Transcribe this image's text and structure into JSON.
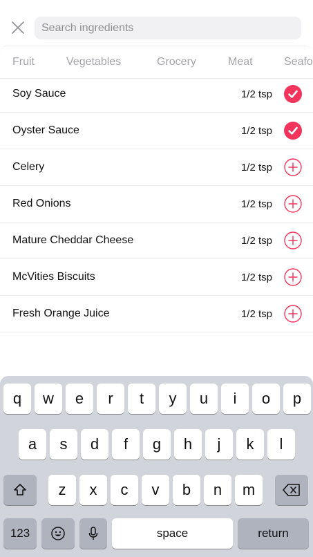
{
  "search": {
    "placeholder": "Search ingredients",
    "value": ""
  },
  "categories": [
    "Fruit",
    "Vegetables",
    "Grocery",
    "Meat",
    "Seafood"
  ],
  "ingredients": [
    {
      "name": "Soy Sauce",
      "qty": "1/2 tsp",
      "added": true
    },
    {
      "name": "Oyster Sauce",
      "qty": "1/2 tsp",
      "added": true
    },
    {
      "name": "Celery",
      "qty": "1/2 tsp",
      "added": false
    },
    {
      "name": "Red Onions",
      "qty": "1/2 tsp",
      "added": false
    },
    {
      "name": "Mature Cheddar Cheese",
      "qty": "1/2 tsp",
      "added": false
    },
    {
      "name": "McVities Biscuits",
      "qty": "1/2 tsp",
      "added": false
    },
    {
      "name": "Fresh Orange Juice",
      "qty": "1/2 tsp",
      "added": false
    }
  ],
  "keyboard": {
    "row1": [
      "q",
      "w",
      "e",
      "r",
      "t",
      "y",
      "u",
      "i",
      "o",
      "p"
    ],
    "row2": [
      "a",
      "s",
      "d",
      "f",
      "g",
      "h",
      "j",
      "k",
      "l"
    ],
    "row3": [
      "z",
      "x",
      "c",
      "v",
      "b",
      "n",
      "m"
    ],
    "numbers_label": "123",
    "space_label": "space",
    "return_label": "return"
  },
  "colors": {
    "accent": "#f2345c",
    "muted": "#a4a4a8"
  }
}
